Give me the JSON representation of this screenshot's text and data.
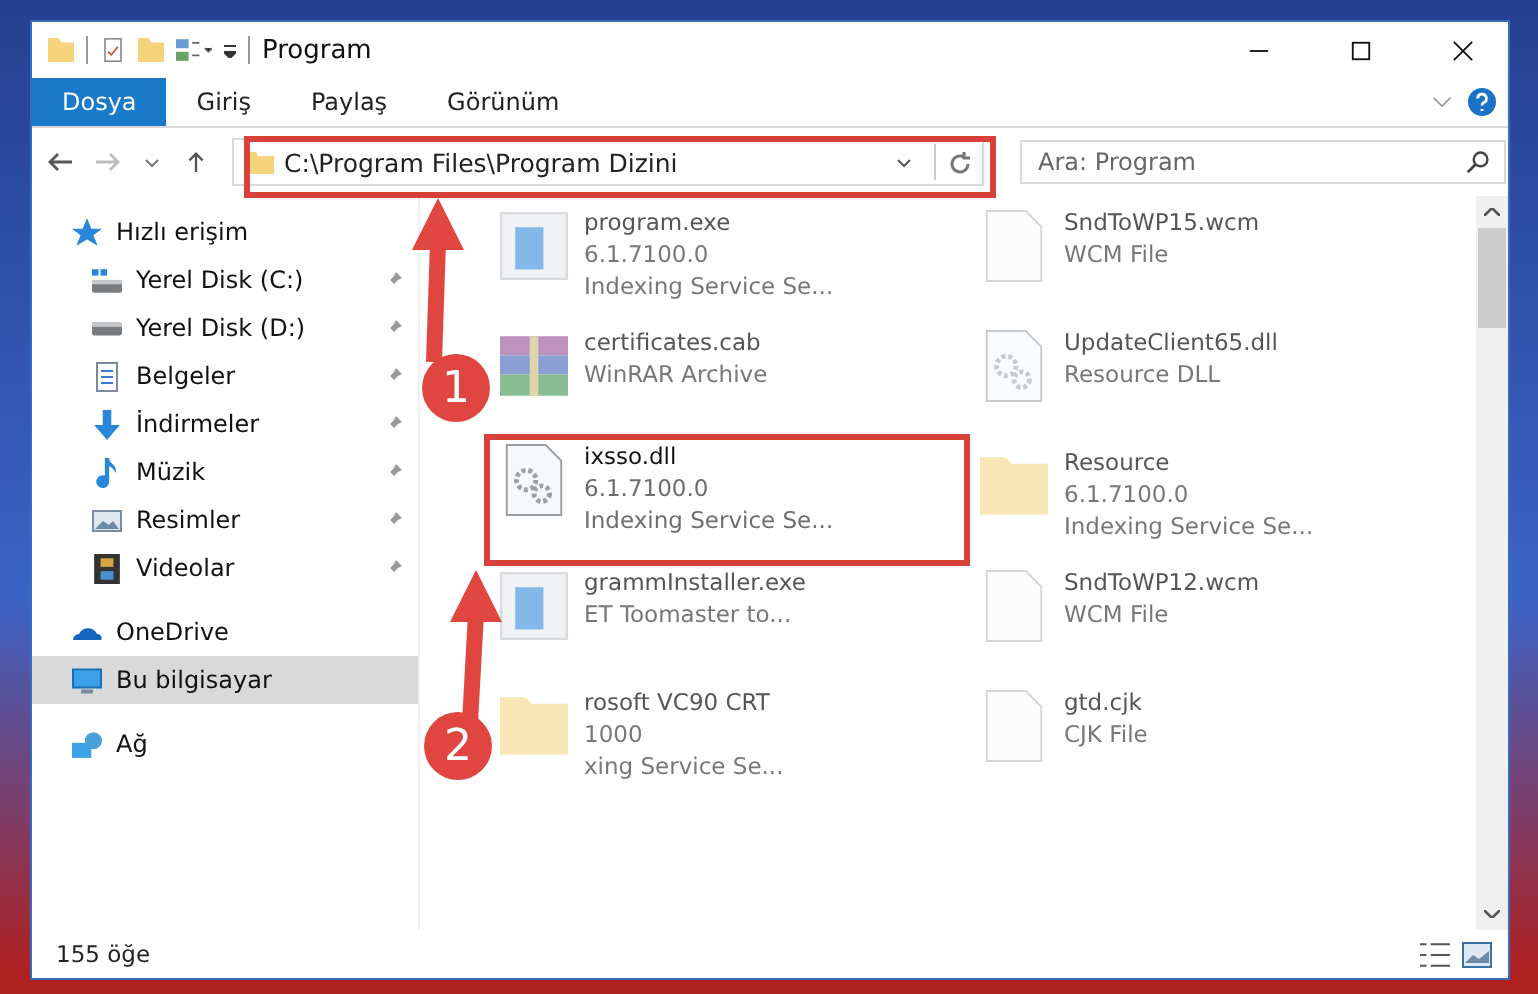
{
  "window": {
    "title": "Program"
  },
  "ribbon_tabs": [
    {
      "label": "Dosya",
      "selected": true
    },
    {
      "label": "Giriş",
      "selected": false
    },
    {
      "label": "Paylaş",
      "selected": false
    },
    {
      "label": "Görünüm",
      "selected": false
    }
  ],
  "address": {
    "path": "C:\\Program Files\\Program Dizini"
  },
  "search": {
    "placeholder": "Ara: Program"
  },
  "sidebar": {
    "items": [
      {
        "label": "Hızlı erişim",
        "selected": false,
        "children": [
          {
            "label": "Yerel Disk (C:)",
            "pinned": true
          },
          {
            "label": "Yerel Disk (D:)",
            "pinned": true
          },
          {
            "label": "Belgeler",
            "pinned": true
          },
          {
            "label": "İndirmeler",
            "pinned": true
          },
          {
            "label": "Müzik",
            "pinned": true
          },
          {
            "label": "Resimler",
            "pinned": true
          },
          {
            "label": "Videolar",
            "pinned": true
          }
        ]
      },
      {
        "label": "OneDrive",
        "selected": false
      },
      {
        "label": "Bu bilgisayar",
        "selected": true
      },
      {
        "label": "Ağ",
        "selected": false
      }
    ]
  },
  "files": [
    {
      "name": "program.exe",
      "lines": [
        "6.1.7100.0",
        "Indexing Service Se..."
      ],
      "dimmed": true,
      "highlighted": false
    },
    {
      "name": "SndToWP15.wcm",
      "lines": [
        "WCM File"
      ],
      "dimmed": true,
      "highlighted": false
    },
    {
      "name": "certificates.cab",
      "lines": [
        "WinRAR Archive"
      ],
      "dimmed": true,
      "highlighted": false
    },
    {
      "name": "UpdateClient65.dll",
      "lines": [
        "Resource DLL"
      ],
      "dimmed": true,
      "highlighted": false
    },
    {
      "name": "ixsso.dll",
      "lines": [
        "6.1.7100.0",
        "Indexing Service Se..."
      ],
      "dimmed": false,
      "highlighted": true
    },
    {
      "name": "Resource",
      "lines": [
        "6.1.7100.0",
        "Indexing Service Se..."
      ],
      "dimmed": true,
      "highlighted": false
    },
    {
      "name": "grammInstaller.exe",
      "lines": [
        "ET Toomaster to..."
      ],
      "dimmed": true,
      "highlighted": false
    },
    {
      "name": "SndToWP12.wcm",
      "lines": [
        "WCM File"
      ],
      "dimmed": true,
      "highlighted": false
    },
    {
      "name": "rosoft VC90 CRT",
      "lines": [
        "1000",
        "xing Service Se..."
      ],
      "dimmed": true,
      "highlighted": false
    },
    {
      "name": "gtd.cjk",
      "lines": [
        "CJK File"
      ],
      "dimmed": true,
      "highlighted": false
    }
  ],
  "status_bar": {
    "count": "155 öğe"
  },
  "annotations": [
    {
      "label": "1"
    },
    {
      "label": "2"
    }
  ]
}
